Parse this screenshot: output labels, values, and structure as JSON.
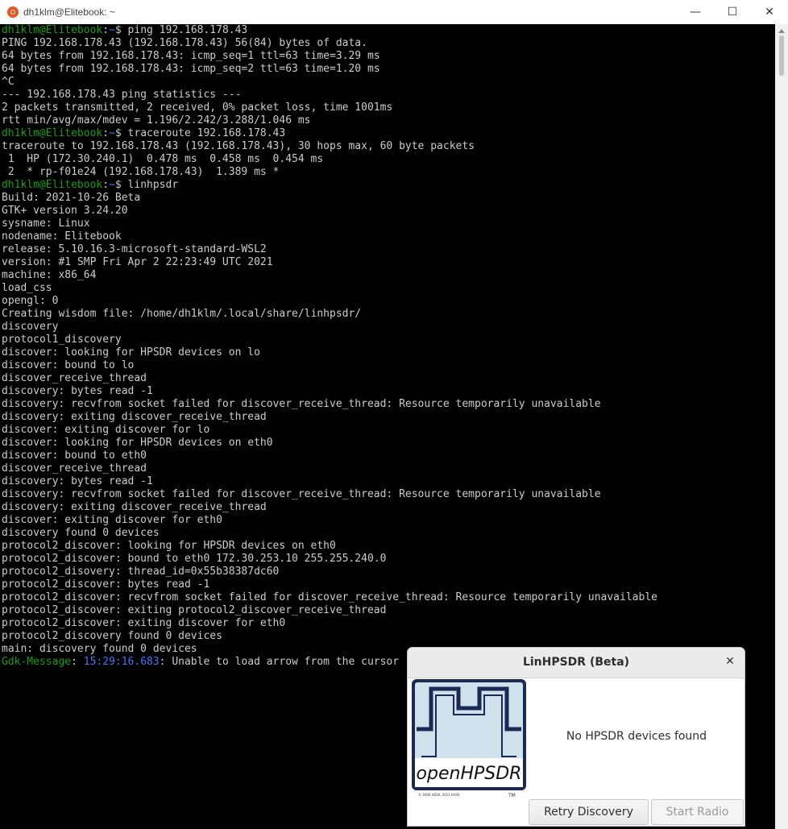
{
  "window": {
    "title": "dh1klm@Elitebook: ~",
    "controls": {
      "minimize": "—",
      "maximize": "☐",
      "close": "✕"
    }
  },
  "terminal": {
    "prompt": {
      "user": "dh1klm@Elitebook",
      "sep": ":",
      "path": "~",
      "symbol": "$ "
    },
    "colors": {
      "user": "#13a10e",
      "path": "#3b78ff",
      "text": "#cccccc",
      "background": "#000000"
    },
    "lines": [
      {
        "type": "prompt",
        "cmd": "ping 192.168.178.43"
      },
      {
        "type": "text",
        "text": "PING 192.168.178.43 (192.168.178.43) 56(84) bytes of data."
      },
      {
        "type": "text",
        "text": "64 bytes from 192.168.178.43: icmp_seq=1 ttl=63 time=3.29 ms"
      },
      {
        "type": "text",
        "text": "64 bytes from 192.168.178.43: icmp_seq=2 ttl=63 time=1.20 ms"
      },
      {
        "type": "text",
        "text": "^C"
      },
      {
        "type": "text",
        "text": "--- 192.168.178.43 ping statistics ---"
      },
      {
        "type": "text",
        "text": "2 packets transmitted, 2 received, 0% packet loss, time 1001ms"
      },
      {
        "type": "text",
        "text": "rtt min/avg/max/mdev = 1.196/2.242/3.288/1.046 ms"
      },
      {
        "type": "prompt",
        "cmd": "traceroute 192.168.178.43"
      },
      {
        "type": "text",
        "text": "traceroute to 192.168.178.43 (192.168.178.43), 30 hops max, 60 byte packets"
      },
      {
        "type": "text",
        "text": " 1  HP (172.30.240.1)  0.478 ms  0.458 ms  0.454 ms"
      },
      {
        "type": "text",
        "text": " 2  * rp-f01e24 (192.168.178.43)  1.389 ms *"
      },
      {
        "type": "prompt",
        "cmd": "linhpsdr"
      },
      {
        "type": "text",
        "text": "Build: 2021-10-26 Beta"
      },
      {
        "type": "text",
        "text": "GTK+ version 3.24.20"
      },
      {
        "type": "text",
        "text": "sysname: Linux"
      },
      {
        "type": "text",
        "text": "nodename: Elitebook"
      },
      {
        "type": "text",
        "text": "release: 5.10.16.3-microsoft-standard-WSL2"
      },
      {
        "type": "text",
        "text": "version: #1 SMP Fri Apr 2 22:23:49 UTC 2021"
      },
      {
        "type": "text",
        "text": "machine: x86_64"
      },
      {
        "type": "text",
        "text": "load_css"
      },
      {
        "type": "text",
        "text": "opengl: 0"
      },
      {
        "type": "text",
        "text": "Creating wisdom file: /home/dh1klm/.local/share/linhpsdr/"
      },
      {
        "type": "text",
        "text": "discovery"
      },
      {
        "type": "text",
        "text": "protocol1_discovery"
      },
      {
        "type": "text",
        "text": "discover: looking for HPSDR devices on lo"
      },
      {
        "type": "text",
        "text": "discover: bound to lo"
      },
      {
        "type": "text",
        "text": "discover_receive_thread"
      },
      {
        "type": "text",
        "text": "discovery: bytes read -1"
      },
      {
        "type": "text",
        "text": "discovery: recvfrom socket failed for discover_receive_thread: Resource temporarily unavailable"
      },
      {
        "type": "text",
        "text": "discovery: exiting discover_receive_thread"
      },
      {
        "type": "text",
        "text": "discover: exiting discover for lo"
      },
      {
        "type": "text",
        "text": "discover: looking for HPSDR devices on eth0"
      },
      {
        "type": "text",
        "text": "discover: bound to eth0"
      },
      {
        "type": "text",
        "text": "discover_receive_thread"
      },
      {
        "type": "text",
        "text": "discovery: bytes read -1"
      },
      {
        "type": "text",
        "text": "discovery: recvfrom socket failed for discover_receive_thread: Resource temporarily unavailable"
      },
      {
        "type": "text",
        "text": "discovery: exiting discover_receive_thread"
      },
      {
        "type": "text",
        "text": "discover: exiting discover for eth0"
      },
      {
        "type": "text",
        "text": "discovery found 0 devices"
      },
      {
        "type": "text",
        "text": "protocol2_discover: looking for HPSDR devices on eth0"
      },
      {
        "type": "text",
        "text": "protocol2_discover: bound to eth0 172.30.253.10 255.255.240.0"
      },
      {
        "type": "text",
        "text": "protocol2_disovery: thread_id=0x55b38387dc60"
      },
      {
        "type": "text",
        "text": "protocol2_discover: bytes read -1"
      },
      {
        "type": "text",
        "text": "protocol2_discover: recvfrom socket failed for discover_receive_thread: Resource temporarily unavailable"
      },
      {
        "type": "text",
        "text": "protocol2_discover: exiting protocol2_discover_receive_thread"
      },
      {
        "type": "text",
        "text": "protocol2_discover: exiting discover for eth0"
      },
      {
        "type": "text",
        "text": "protocol2_discovery found 0 devices"
      },
      {
        "type": "text",
        "text": "main: discovery found 0 devices"
      },
      {
        "type": "gdk",
        "name": "Gdk-Message",
        "sep": ": ",
        "time": "15:29:16.683",
        "text": ": Unable to load arrow from the cursor"
      }
    ]
  },
  "dialog": {
    "title": "LinHPSDR (Beta)",
    "close_glyph": "✕",
    "message": "No HPSDR devices found",
    "logo": {
      "text": "openHPSDR",
      "copyright": "© 2006 AE5K, 2011 KV0S",
      "tm": "TM",
      "frame_color": "#1a2a55",
      "bg_color": "#c9dde6"
    },
    "retry_label": "Retry Discovery",
    "start_label": "Start Radio"
  }
}
